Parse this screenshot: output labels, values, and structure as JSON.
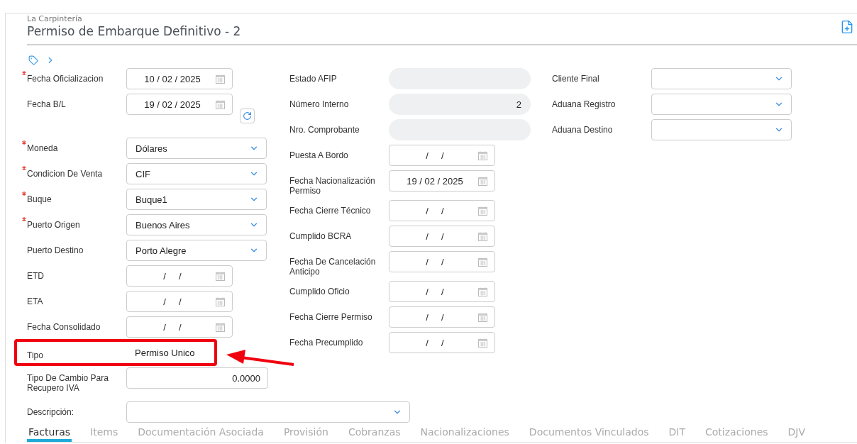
{
  "header": {
    "company": "La Carpintería",
    "title": "Permiso de Embarque Definitivo - 2"
  },
  "columns": [
    [
      {
        "kind": "date",
        "label": "Fecha Oficializacion",
        "required": true,
        "value": "10 / 02 / 2025"
      },
      {
        "kind": "date",
        "label": "Fecha B/L",
        "required": false,
        "value": "19 / 02 / 2025",
        "has_refresh": true
      },
      {
        "kind": "select",
        "label": "Moneda",
        "required": true,
        "value": "Dólares"
      },
      {
        "kind": "select",
        "label": "Condicion De Venta",
        "required": true,
        "value": "CIF"
      },
      {
        "kind": "select",
        "label": "Buque",
        "required": true,
        "value": "Buque1"
      },
      {
        "kind": "select",
        "label": "Puerto Origen",
        "required": true,
        "value": "Buenos Aires"
      },
      {
        "kind": "select",
        "label": "Puerto Destino",
        "required": false,
        "value": "Porto Alegre"
      },
      {
        "kind": "date",
        "label": "ETD",
        "required": false,
        "value": "/     /"
      },
      {
        "kind": "date",
        "label": "ETA",
        "required": false,
        "value": "/     /"
      },
      {
        "kind": "date",
        "label": "Fecha Consolidado",
        "required": false,
        "value": "/     /"
      },
      {
        "kind": "static",
        "label": "Tipo",
        "required": false,
        "value": "Permiso Unico",
        "highlighted": true
      },
      {
        "kind": "number",
        "label": "Tipo De Cambio Para Recupero IVA",
        "required": false,
        "value": "0.0000"
      },
      {
        "kind": "wide-select",
        "label": "Descripción:",
        "required": false
      }
    ],
    [
      {
        "kind": "readonly",
        "label": "Estado AFIP"
      },
      {
        "kind": "readonly",
        "label": "Número Interno",
        "value": "2"
      },
      {
        "kind": "readonly",
        "label": "Nro. Comprobante"
      },
      {
        "kind": "date",
        "label": "Puesta A Bordo",
        "value": "/     /"
      },
      {
        "kind": "date",
        "label": "Fecha Nacionalización Permiso",
        "value": "19 / 02 / 2025"
      },
      {
        "kind": "date",
        "label": "Fecha Cierre Técnico",
        "value": "/     /"
      },
      {
        "kind": "date",
        "label": "Cumplido BCRA",
        "value": "/     /"
      },
      {
        "kind": "date",
        "label": "Fecha De Cancelación Anticipo",
        "value": "/     /"
      },
      {
        "kind": "date",
        "label": "Cumplido Oficio",
        "value": "/     /"
      },
      {
        "kind": "date",
        "label": "Fecha Cierre Permiso",
        "value": "/     /"
      },
      {
        "kind": "date",
        "label": "Fecha Precumplido",
        "value": "/     /"
      }
    ],
    [
      {
        "kind": "select",
        "label": "Cliente Final"
      },
      {
        "kind": "select",
        "label": "Aduana Registro"
      },
      {
        "kind": "select",
        "label": "Aduana Destino"
      }
    ]
  ],
  "tabs": [
    {
      "label": "Facturas",
      "selected": true
    },
    {
      "label": "Items",
      "selected": false
    },
    {
      "label": "Documentación Asociada",
      "selected": false
    },
    {
      "label": "Provisión",
      "selected": false
    },
    {
      "label": "Cobranzas",
      "selected": false
    },
    {
      "label": "Nacionalizaciones",
      "selected": false
    },
    {
      "label": "Documentos Vinculados",
      "selected": false
    },
    {
      "label": "DIT",
      "selected": false
    },
    {
      "label": "Cotizaciones",
      "selected": false
    },
    {
      "label": "DJV",
      "selected": false
    }
  ]
}
